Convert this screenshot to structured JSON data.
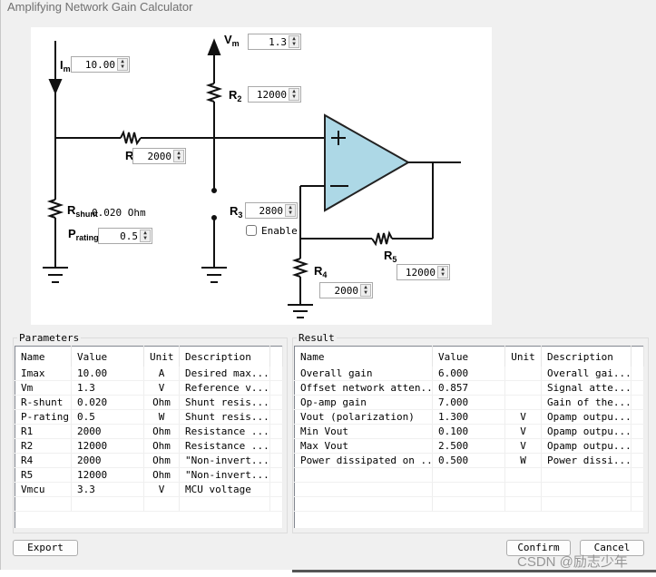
{
  "window": {
    "title": "Amplifying Network Gain Calculator"
  },
  "circuit": {
    "im": {
      "label": "I",
      "sub": "m",
      "value": "10.00"
    },
    "vm": {
      "label": "V",
      "sub": "m",
      "value": "1.3"
    },
    "r1": {
      "label": "R",
      "value": "2000"
    },
    "r2": {
      "label": "R",
      "sub": "2",
      "value": "12000"
    },
    "r3": {
      "label": "R",
      "sub": "3",
      "value": "2800",
      "enable_label": "Enable",
      "enabled": false
    },
    "r4": {
      "label": "R",
      "sub": "4",
      "value": "2000"
    },
    "r5": {
      "label": "R",
      "sub": "5",
      "value": "12000"
    },
    "rshunt": {
      "label": "R",
      "sub": "shunt",
      "value": "0.020 Ohm"
    },
    "prating": {
      "label": "P",
      "sub": "rating",
      "value": "0.5"
    },
    "opamp_color": "#add8e6"
  },
  "parameters": {
    "title": "Parameters",
    "columns": [
      "Name",
      "Value",
      "Unit",
      "Description"
    ],
    "rows": [
      [
        "Imax",
        "10.00",
        "A",
        "Desired max..."
      ],
      [
        "Vm",
        "1.3",
        "V",
        "Reference v..."
      ],
      [
        "R-shunt",
        "0.020",
        "Ohm",
        "Shunt resis..."
      ],
      [
        "P-rating",
        "0.5",
        "W",
        "Shunt resis..."
      ],
      [
        "R1",
        "2000",
        "Ohm",
        "Resistance ..."
      ],
      [
        "R2",
        "12000",
        "Ohm",
        "Resistance ..."
      ],
      [
        "R4",
        "2000",
        "Ohm",
        "\"Non-invert..."
      ],
      [
        "R5",
        "12000",
        "Ohm",
        "\"Non-invert..."
      ],
      [
        "Vmcu",
        "3.3",
        "V",
        "MCU voltage"
      ]
    ]
  },
  "result": {
    "title": "Result",
    "columns": [
      "Name",
      "Value",
      "Unit",
      "Description"
    ],
    "rows": [
      [
        "Overall gain",
        "6.000",
        "",
        "Overall gai..."
      ],
      [
        "Offset network atten...",
        "0.857",
        "",
        "Signal atte..."
      ],
      [
        "Op-amp gain",
        "7.000",
        "",
        "Gain of the..."
      ],
      [
        "Vout (polarization)",
        "1.300",
        "V",
        "Opamp outpu..."
      ],
      [
        "Min Vout",
        "0.100",
        "V",
        "Opamp outpu..."
      ],
      [
        "Max Vout",
        "2.500",
        "V",
        "Opamp outpu..."
      ],
      [
        "Power dissipated on ...",
        "0.500",
        "W",
        "Power dissi..."
      ]
    ]
  },
  "buttons": {
    "export": "Export",
    "confirm": "Confirm",
    "cancel": "Cancel"
  },
  "watermark": "CSDN @励志少年"
}
